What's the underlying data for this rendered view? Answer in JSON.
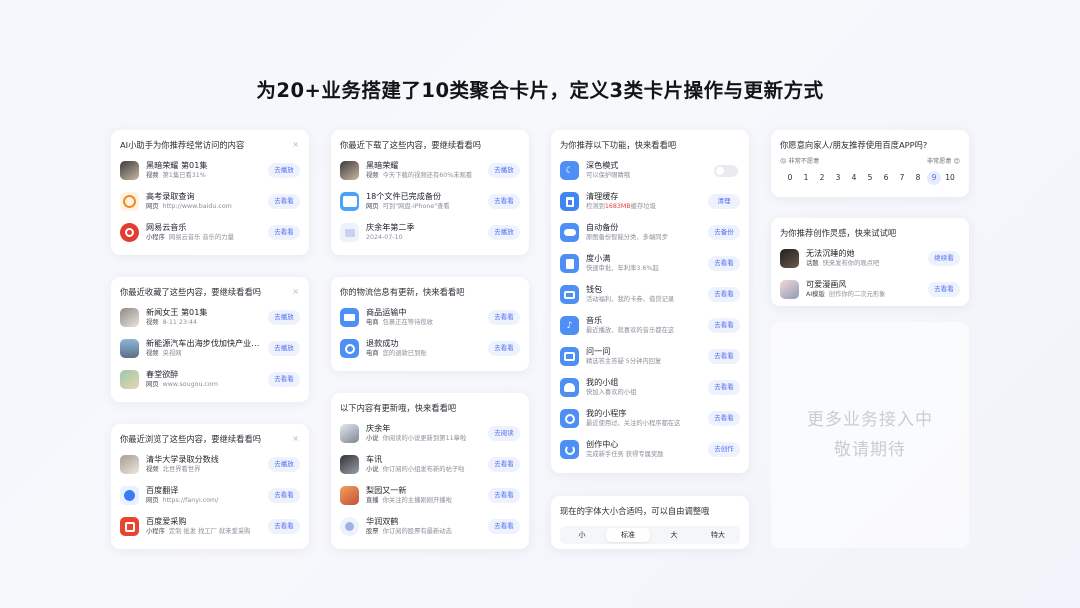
{
  "headline": "为20+业务搭建了10类聚合卡片，定义3类卡片操作与更新方式",
  "cards": {
    "ai_assistant": {
      "title": "AI小助手为你推荐经常访问的内容",
      "close": "×",
      "items": [
        {
          "name": "黑暗荣耀 第01集",
          "tag": "视频",
          "sub": "第1集已看31%",
          "button": "去播放"
        },
        {
          "name": "高考录取查询",
          "tag": "网页",
          "sub": "http://www.baidu.com",
          "button": "去看看"
        },
        {
          "name": "网易云音乐",
          "tag": "小程序",
          "sub": "网易云音乐 音乐的力量",
          "button": "去看看"
        }
      ]
    },
    "downloads": {
      "title": "你最近下载了这些内容，要继续看看吗",
      "items": [
        {
          "name": "黑暗荣耀",
          "tag": "视频",
          "sub": "今天下载的视频还有60%未观看",
          "button": "去播放"
        },
        {
          "name": "18个文件已完成备份",
          "tag": "网页",
          "sub": "可到\"网盘-iPhone\"查看",
          "button": "去看看"
        },
        {
          "name": "庆余年第二季",
          "tag": "",
          "sub": "2024-07-10",
          "button": "去播放"
        }
      ]
    },
    "features": {
      "title": "为你推荐以下功能，快来看看吧",
      "items": [
        {
          "name": "深色模式",
          "sub": "可以保护眼睛哦",
          "button": ""
        },
        {
          "name": "清理缓存",
          "sub_pre": "检测到",
          "sub_red": "1683MB",
          "sub_post": "缓存垃圾",
          "button": "清理"
        },
        {
          "name": "自动备份",
          "sub": "原图备份智能分类、多端同步",
          "button": "去备份"
        },
        {
          "name": "度小满",
          "sub": "快速审批、年利率3.6%起",
          "button": "去看看"
        },
        {
          "name": "钱包",
          "sub": "活动福利、我的卡券、借贷记录",
          "button": "去看看"
        },
        {
          "name": "音乐",
          "sub": "最近播放、就喜欢的音乐都在这",
          "button": "去看看"
        },
        {
          "name": "问一问",
          "sub": "精选答主答疑 5分钟内回复",
          "button": "去看看"
        },
        {
          "name": "我的小组",
          "sub": "快加入喜欢的小组",
          "button": "去看看"
        },
        {
          "name": "我的小程序",
          "sub": "最近使用过、关注的小程序都在这",
          "button": "去看看"
        },
        {
          "name": "创作中心",
          "sub": "完成新手任务 获得专属奖励",
          "button": "去创作"
        }
      ]
    },
    "recommend_app": {
      "title": "你愿意向家人/朋友推荐使用百度APP吗?",
      "low_label": "😣 非常不愿意",
      "high_label": "非常愿意 😍",
      "scale": [
        "0",
        "1",
        "2",
        "3",
        "4",
        "5",
        "6",
        "7",
        "8",
        "9",
        "10"
      ],
      "selected": "9"
    },
    "creation": {
      "title": "为你推荐创作灵感，快来试试吧",
      "items": [
        {
          "name": "无法沉睡的她",
          "tag": "话题",
          "sub": "快来发布你的观点吧",
          "button": "继续看"
        },
        {
          "name": "可爱漫画风",
          "tag": "AI模版",
          "sub": "创作你的二次元形象",
          "button": "去看看"
        }
      ]
    },
    "favorites": {
      "title": "你最近收藏了这些内容，要继续看看吗",
      "close": "×",
      "items": [
        {
          "name": "新闻女王 第01集",
          "tag": "视频",
          "sub": "8-11  23:44",
          "button": "去播放"
        },
        {
          "name": "新能源汽车出海步伐加快产业经…",
          "tag": "视频",
          "sub": "央视网",
          "button": "去播放"
        },
        {
          "name": "春堂欲醉",
          "tag": "网页",
          "sub": "www.sougou.com",
          "button": "去看看"
        }
      ]
    },
    "logistics": {
      "title": "你的物流信息有更新，快来看看吧",
      "items": [
        {
          "name": "商品运输中",
          "tag": "电商",
          "sub": "包裹正在等待揽收",
          "button": "去看看"
        },
        {
          "name": "退款成功",
          "tag": "电商",
          "sub": "您的退款已到账",
          "button": "去看看"
        }
      ]
    },
    "browsed": {
      "title": "你最近浏览了这些内容，要继续看看吗",
      "close": "×",
      "items": [
        {
          "name": "清华大学录取分数线",
          "tag": "视频",
          "sub": "北世界看世界",
          "button": "去播放"
        },
        {
          "name": "百度翻译",
          "tag": "网页",
          "sub": "https://fanyi.com/",
          "button": "去看看"
        },
        {
          "name": "百度爱采购",
          "tag": "小程序",
          "sub": "定制 批发 找工厂 就来爱采购",
          "button": "去看看"
        }
      ]
    },
    "updates": {
      "title": "以下内容有更新哦，快来看看吧",
      "items": [
        {
          "name": "庆余年",
          "tag": "小说",
          "sub": "你阅读的小说更新到第11章啦",
          "button": "去阅读"
        },
        {
          "name": "车讯",
          "tag": "小说",
          "sub": "你订阅的小组发布新的帖子啦",
          "button": "去看看"
        },
        {
          "name": "梨园又一新",
          "tag": "直播",
          "sub": "你关注的主播刚刚开播啦",
          "button": "去看看"
        },
        {
          "name": "华润双鹤",
          "tag": "股票",
          "sub": "你订阅的股票有最新动态",
          "button": "去看看"
        }
      ]
    },
    "font_size": {
      "title": "现在的字体大小合适吗，可以自由调整哦",
      "options": [
        "小",
        "标准",
        "大",
        "特大"
      ],
      "selected": "标准"
    }
  },
  "coming_soon": {
    "line1": "更多业务接入中",
    "line2": "敬请期待"
  },
  "colors": {
    "accent": "#4e6ef2",
    "button_bg": "#eef2fd",
    "icon_blue": "#4d8ff5",
    "warning": "#e8413a"
  }
}
